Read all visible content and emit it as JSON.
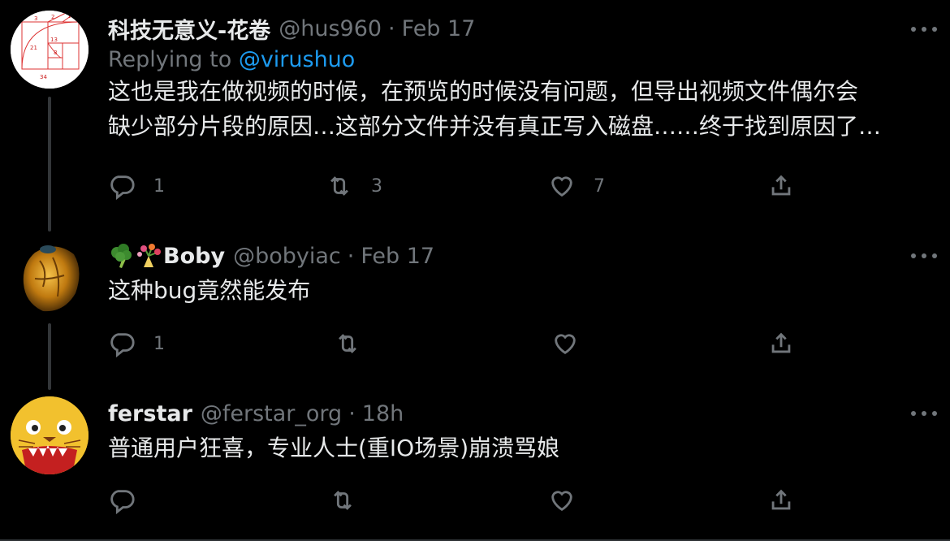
{
  "tweets": [
    {
      "name": "科技无意义-花卷",
      "handle": "@hus960",
      "time": "Feb 17",
      "replying_label": "Replying to",
      "replying_to": "@virushuo",
      "text_line1": "这也是我在做视频的时候，在预览的时候没有问题，但导出视频文件偶尔会",
      "text_line2": "缺少部分片段的原因…这部分文件并没有真正写入磁盘……终于找到原因了…",
      "replies": "1",
      "retweets": "3",
      "likes": "7"
    },
    {
      "name": "Boby",
      "name_emojis": [
        "broccoli-emoji",
        "bouquet-emoji"
      ],
      "handle": "@bobyiac",
      "time": "Feb 17",
      "text": "这种bug竟然能发布",
      "replies": "1",
      "retweets": "",
      "likes": ""
    },
    {
      "name": "ferstar",
      "handle": "@ferstar_org",
      "time": "18h",
      "text": "普通用户狂喜，专业人士(重IO场景)崩溃骂娘",
      "replies": "",
      "retweets": "",
      "likes": ""
    }
  ],
  "separator": "·",
  "icons": [
    "reply-icon",
    "retweet-icon",
    "like-icon",
    "share-icon",
    "more-icon"
  ],
  "colors": {
    "background": "#000000",
    "text": "#e7e9ea",
    "muted": "#71767b",
    "link": "#1d9bf0"
  },
  "avatar1_digits": [
    "3",
    "2",
    "1",
    "21",
    "13",
    "8",
    "34"
  ]
}
